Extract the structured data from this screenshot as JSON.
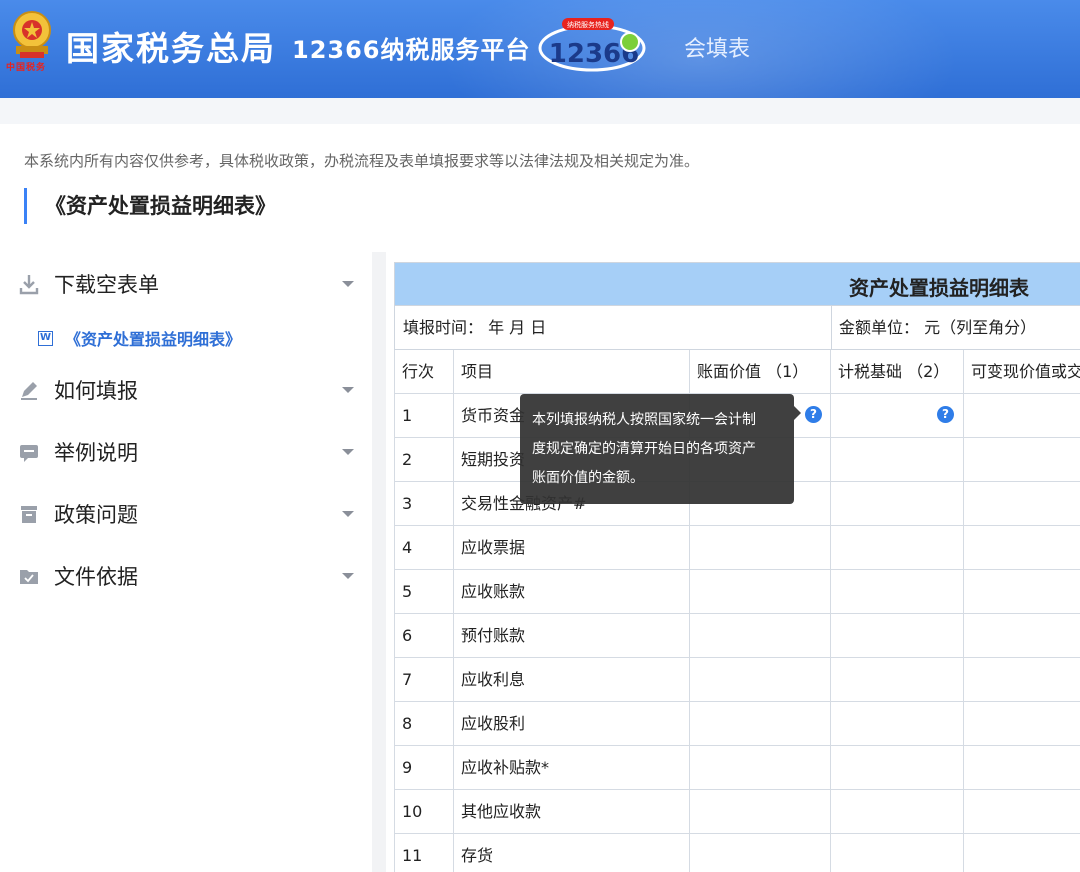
{
  "header": {
    "title": "国家税务总局",
    "platform": "12366纳税服务平台",
    "logo_text": "12366",
    "logo_tag": "纳税服务热线",
    "subtitle": "会填表",
    "emblem_caption": "中国税务",
    "brand_color": "#2f6fd6"
  },
  "notice": "本系统内所有内容仅供参考，具体税收政策，办税流程及表单填报要求等以法律法规及相关规定为准。",
  "page_title": "《资产处置损益明细表》",
  "sidebar": {
    "items": [
      {
        "label": "下载空表单",
        "icon": "download-icon"
      },
      {
        "label": "如何填报",
        "icon": "pen-icon"
      },
      {
        "label": "举例说明",
        "icon": "message-icon"
      },
      {
        "label": "政策问题",
        "icon": "archive-icon"
      },
      {
        "label": "文件依据",
        "icon": "folder-icon"
      }
    ],
    "sub_item": {
      "label": "《资产处置损益明细表》",
      "icon": "word-doc-icon",
      "icon_letter": "W"
    }
  },
  "table": {
    "title": "资产处置损益明细表",
    "fill_time": "填报时间：  年  月  日",
    "unit": "金额单位：  元（列至角分）",
    "headers": [
      "行次",
      "项目",
      "账面价值  （1）",
      "计税基础  （2）",
      "可变现价值或交易价格"
    ],
    "rows": [
      [
        "1",
        "货币资金"
      ],
      [
        "2",
        "短期投资"
      ],
      [
        "3",
        "交易性金融资产#"
      ],
      [
        "4",
        "应收票据"
      ],
      [
        "5",
        "应收账款"
      ],
      [
        "6",
        "预付账款"
      ],
      [
        "7",
        "应收利息"
      ],
      [
        "8",
        "应收股利"
      ],
      [
        "9",
        "应收补贴款*"
      ],
      [
        "10",
        "其他应收款"
      ],
      [
        "11",
        "存货"
      ]
    ],
    "help_mark": "?"
  },
  "tooltip": {
    "lines": [
      "本列填报纳税人按照国家统一会计制",
      "度规定确定的清算开始日的各项资产",
      "账面价值的金额。"
    ]
  }
}
